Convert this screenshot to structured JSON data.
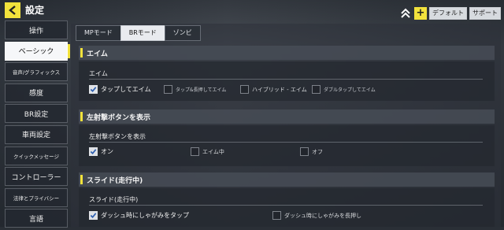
{
  "header": {
    "title": "設定",
    "default_label": "デフォルト",
    "support_label": "サポート",
    "plus_label": "+"
  },
  "sidebar": {
    "items": [
      {
        "label": "操作"
      },
      {
        "label": "ベーシック"
      },
      {
        "label": "音声/グラフィックス"
      },
      {
        "label": "感度"
      },
      {
        "label": "BR設定"
      },
      {
        "label": "車両設定"
      },
      {
        "label": "クイックメッセージ"
      },
      {
        "label": "コントローラー"
      },
      {
        "label": "法律とプライバシー"
      },
      {
        "label": "言語"
      }
    ],
    "active_index": 1
  },
  "tabs": [
    {
      "label": "MPモード"
    },
    {
      "label": "BRモード"
    },
    {
      "label": "ゾンビ"
    }
  ],
  "active_tab": 1,
  "sections": {
    "aim": {
      "header": "エイム",
      "sub_label": "エイム",
      "options": [
        {
          "label": "タップしてエイム",
          "checked": true
        },
        {
          "label": "タップ&長押してエイム",
          "checked": false
        },
        {
          "label": "ハイブリッド - エイム",
          "checked": false
        },
        {
          "label": "ダブルタップしてエイム",
          "checked": false
        }
      ]
    },
    "fire": {
      "header": "左射撃ボタンを表示",
      "sub_label": "左射撃ボタンを表示",
      "options": [
        {
          "label": "オン",
          "checked": true
        },
        {
          "label": "エイム中",
          "checked": false
        },
        {
          "label": "オフ",
          "checked": false
        }
      ]
    },
    "slide": {
      "header": "スライド(走行中)",
      "sub_label": "スライド(走行中)",
      "options": [
        {
          "label": "ダッシュ時にしゃがみをタップ",
          "checked": true
        },
        {
          "label": "ダッシュ時にしゃがみを長押し",
          "checked": false
        }
      ]
    }
  },
  "colors": {
    "accent": "#f2e23c"
  }
}
